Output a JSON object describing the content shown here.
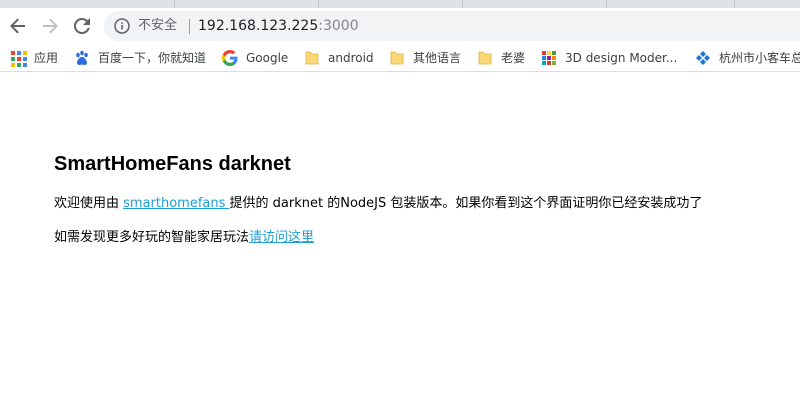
{
  "browser": {
    "security_label": "不安全",
    "url_host": "192.168.123.225",
    "url_port": ":3000"
  },
  "bookmarks": [
    {
      "label": "应用",
      "icon": "apps-grid-icon"
    },
    {
      "label": "百度一下，你就知道",
      "icon": "baidu-paw-icon"
    },
    {
      "label": "Google",
      "icon": "google-g-icon"
    },
    {
      "label": "android",
      "icon": "folder-icon"
    },
    {
      "label": "其他语言",
      "icon": "folder-icon"
    },
    {
      "label": "老婆",
      "icon": "folder-icon"
    },
    {
      "label": "3D design Moder...",
      "icon": "colorful-grid-icon"
    },
    {
      "label": "杭州市小客车总",
      "icon": "blue-diamond-icon"
    }
  ],
  "page": {
    "title": "SmartHomeFans darknet",
    "line1_prefix": "欢迎使用由 ",
    "line1_link": "smarthomefans ",
    "line1_suffix": "提供的 darknet 的NodeJS 包装版本。如果你看到这个界面证明你已经安装成功了",
    "line2_prefix": "如需发现更多好玩的智能家居玩法",
    "line2_link": "请访问这里"
  },
  "colors": {
    "link": "#1a9fd5",
    "folder": "#f8d775",
    "omnibox_bg": "#f1f3f4"
  }
}
